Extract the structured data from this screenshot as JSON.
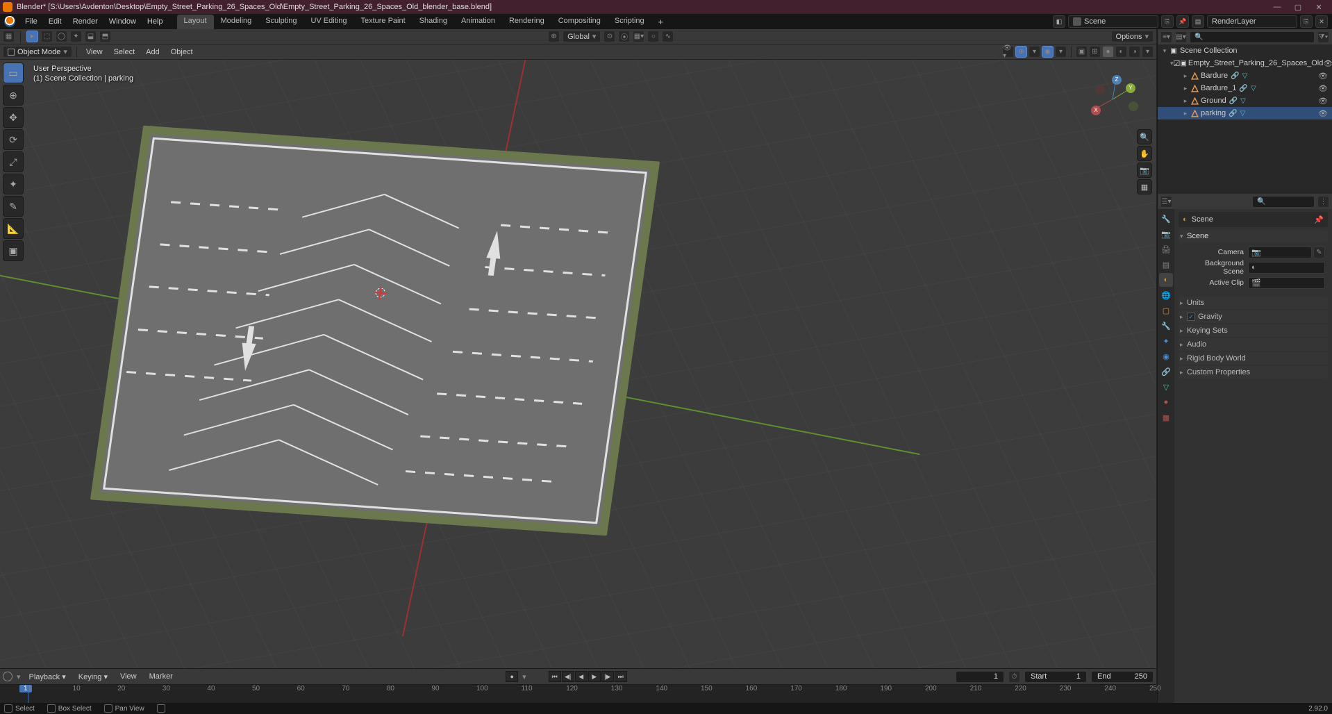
{
  "titlebar": {
    "app_title": "Blender* [S:\\Users\\Avdenton\\Desktop\\Empty_Street_Parking_26_Spaces_Old\\Empty_Street_Parking_26_Spaces_Old_blender_base.blend]"
  },
  "menubar": {
    "items": [
      "File",
      "Edit",
      "Render",
      "Window",
      "Help"
    ],
    "workspaces": [
      "Layout",
      "Modeling",
      "Sculpting",
      "UV Editing",
      "Texture Paint",
      "Shading",
      "Animation",
      "Rendering",
      "Compositing",
      "Scripting"
    ],
    "active_workspace": 0,
    "scene_label": "Scene",
    "viewlayer_label": "RenderLayer"
  },
  "tool_header": {
    "orientation": "Global",
    "options_label": "Options"
  },
  "view_header": {
    "mode": "Object Mode",
    "menus": [
      "View",
      "Select",
      "Add",
      "Object"
    ]
  },
  "viewport": {
    "overlay_line1": "User Perspective",
    "overlay_line2": "(1) Scene Collection | parking",
    "gizmo": {
      "x": "X",
      "y": "Y",
      "z": "Z"
    }
  },
  "timeline": {
    "menus": [
      "Playback",
      "Keying",
      "View",
      "Marker"
    ],
    "frame_current": "1",
    "start_label": "Start",
    "start_value": "1",
    "end_label": "End",
    "end_value": "250",
    "ticks": [
      "1",
      "10",
      "20",
      "30",
      "40",
      "50",
      "60",
      "70",
      "80",
      "90",
      "100",
      "110",
      "120",
      "130",
      "140",
      "150",
      "160",
      "170",
      "180",
      "190",
      "200",
      "210",
      "220",
      "230",
      "240",
      "250"
    ]
  },
  "outliner": {
    "root": "Scene Collection",
    "coll": "Empty_Street_Parking_26_Spaces_Old",
    "items": [
      {
        "name": "Bardure",
        "selected": false
      },
      {
        "name": "Bardure_1",
        "selected": false
      },
      {
        "name": "Ground",
        "selected": false
      },
      {
        "name": "parking",
        "selected": true
      }
    ]
  },
  "properties": {
    "breadcrumb": "Scene",
    "panel_scene": "Scene",
    "camera_label": "Camera",
    "bg_scene_label": "Background Scene",
    "active_clip_label": "Active Clip",
    "sections": [
      "Units",
      "Gravity",
      "Keying Sets",
      "Audio",
      "Rigid Body World",
      "Custom Properties"
    ],
    "gravity_checked": true
  },
  "statusbar": {
    "select": "Select",
    "box_select": "Box Select",
    "pan_view": "Pan View",
    "version": "2.92.0"
  }
}
